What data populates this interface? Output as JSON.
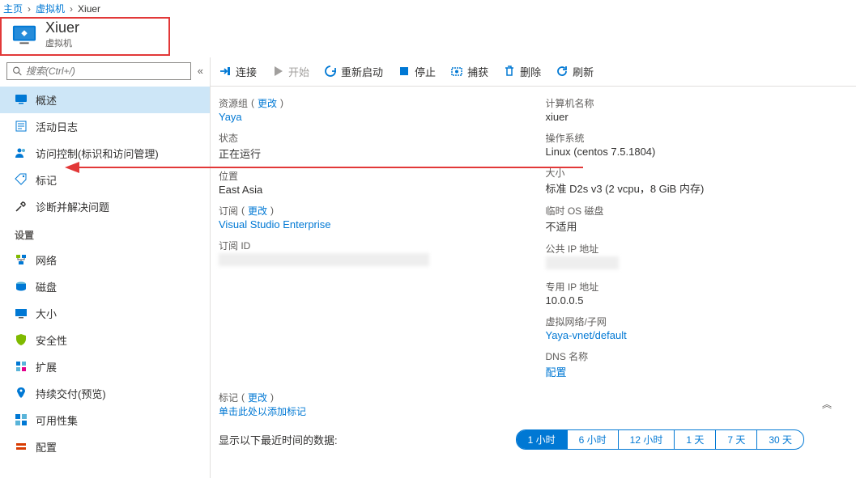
{
  "breadcrumb": {
    "home": "主页",
    "level1": "虚拟机",
    "current": "Xiuer"
  },
  "header": {
    "title": "Xiuer",
    "subtitle": "虚拟机"
  },
  "search": {
    "placeholder": "搜索(Ctrl+/)"
  },
  "nav": {
    "overview": "概述",
    "activity": "活动日志",
    "iam": "访问控制(标识和访问管理)",
    "tags": "标记",
    "diagnose": "诊断并解决问题",
    "section_settings": "设置",
    "networking": "网络",
    "disks": "磁盘",
    "size": "大小",
    "security": "安全性",
    "extensions": "扩展",
    "cicd": "持续交付(预览)",
    "availset": "可用性集",
    "config": "配置"
  },
  "toolbar": {
    "connect": "连接",
    "start": "开始",
    "restart": "重新启动",
    "stop": "停止",
    "capture": "捕获",
    "delete": "删除",
    "refresh": "刷新"
  },
  "left": {
    "resourceGroup_label": "资源组",
    "change": "更改",
    "resourceGroup_value": "Yaya",
    "status_label": "状态",
    "status_value": "正在运行",
    "location_label": "位置",
    "location_value": "East Asia",
    "subscription_label": "订阅",
    "subscription_value": "Visual Studio Enterprise",
    "subscriptionId_label": "订阅 ID"
  },
  "right": {
    "computerName_label": "计算机名称",
    "computerName_value": "xiuer",
    "os_label": "操作系统",
    "os_value": "Linux (centos 7.5.1804)",
    "size_label": "大小",
    "size_value": "标准 D2s v3 (2 vcpu，8 GiB 内存)",
    "tempdisk_label": "临时 OS 磁盘",
    "tempdisk_value": "不适用",
    "publicip_label": "公共 IP 地址",
    "privateip_label": "专用 IP 地址",
    "privateip_value": "10.0.0.5",
    "vnet_label": "虚拟网络/子网",
    "vnet_value": "Yaya-vnet/default",
    "dns_label": "DNS 名称",
    "dns_value": "配置"
  },
  "tags": {
    "label": "标记",
    "change": "更改",
    "hint": "单击此处以添加标记"
  },
  "footer": {
    "label": "显示以下最近时间的数据:",
    "pills": [
      "1 小时",
      "6 小时",
      "12 小时",
      "1 天",
      "7 天",
      "30 天"
    ]
  }
}
